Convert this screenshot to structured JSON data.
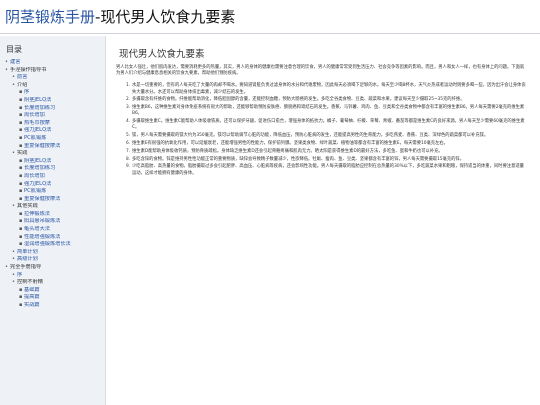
{
  "header": {
    "site_name": "阴茎锻炼手册",
    "page_title": "-现代男人饮食九要素"
  },
  "toc": {
    "title": "目录",
    "items": [
      {
        "level": 0,
        "bullet": "",
        "label": "建言",
        "link": true
      },
      {
        "level": 0,
        "bullet": "",
        "label": "手淫操作指导书",
        "link": false
      },
      {
        "level": 1,
        "bullet": "",
        "label": "前言",
        "link": true
      },
      {
        "level": 1,
        "bullet": "",
        "label": "介绍",
        "link": false
      },
      {
        "level": 2,
        "bullet": "",
        "label": "序",
        "link": true
      },
      {
        "level": 2,
        "bullet": "",
        "label": "阴茎JELQ法",
        "link": true
      },
      {
        "level": 2,
        "bullet": "",
        "label": "长度增加练习",
        "link": true
      },
      {
        "level": 2,
        "bullet": "",
        "label": "周长增加",
        "link": true
      },
      {
        "level": 2,
        "bullet": "",
        "label": "热毛巾按摩",
        "link": true
      },
      {
        "level": 2,
        "bullet": "",
        "label": "强力JELQ法",
        "link": true
      },
      {
        "level": 2,
        "bullet": "",
        "label": "PC肌锻炼",
        "link": true
      },
      {
        "level": 2,
        "bullet": "",
        "label": "重复保健按摩法",
        "link": true
      },
      {
        "level": 1,
        "bullet": "",
        "label": "实践",
        "link": false
      },
      {
        "level": 2,
        "bullet": "",
        "label": "阴茎JELQ法",
        "link": true
      },
      {
        "level": 2,
        "bullet": "",
        "label": "长度增加练习",
        "link": true
      },
      {
        "level": 2,
        "bullet": "",
        "label": "周长增加",
        "link": true
      },
      {
        "level": 2,
        "bullet": "",
        "label": "强力JELQ法",
        "link": true
      },
      {
        "level": 2,
        "bullet": "",
        "label": "PC肌锻炼",
        "link": true
      },
      {
        "level": 2,
        "bullet": "",
        "label": "重复保健按摩法",
        "link": true
      },
      {
        "level": 1,
        "bullet": "",
        "label": "其他实践",
        "link": false
      },
      {
        "level": 2,
        "bullet": "",
        "label": "拉伸锻炼法",
        "link": true
      },
      {
        "level": 2,
        "bullet": "",
        "label": "阳具悬吊锻炼法",
        "link": true
      },
      {
        "level": 2,
        "bullet": "",
        "label": "龟头增大法",
        "link": true
      },
      {
        "level": 2,
        "bullet": "",
        "label": "性能增强锻炼法",
        "link": true
      },
      {
        "level": 2,
        "bullet": "",
        "label": "湿润增强锻炼增长法",
        "link": true
      },
      {
        "level": 1,
        "bullet": "",
        "label": "简单计划",
        "link": true
      },
      {
        "level": 1,
        "bullet": "",
        "label": "高级计划",
        "link": true
      },
      {
        "level": 0,
        "bullet": "",
        "label": "完全手册指导",
        "link": false
      },
      {
        "level": 1,
        "bullet": "",
        "label": "序",
        "link": true
      },
      {
        "level": 1,
        "bullet": "",
        "label": "控制不射精",
        "link": false
      },
      {
        "level": 2,
        "bullet": "",
        "label": "基础篇",
        "link": true
      },
      {
        "level": 2,
        "bullet": "",
        "label": "提高篇",
        "link": true
      },
      {
        "level": 2,
        "bullet": "",
        "label": "实战篇",
        "link": true
      }
    ]
  },
  "content": {
    "title": "现代男人饮食九要素",
    "intro": "男人比女人强壮，他们肌肉发达，需要消耗更多的热量，其实，男人的身体的健康也需要注意合理的饮食，男人的健康常常受到生活压力、社会竞争等因素的影响。而且，男人和女人一样，也有身体上的问题。下面就为男人们介绍与健康息息相关的饮食九要素，帮助他们预防疾病。",
    "items": [
      "水是一切重要的，但有的人每天吃了大量的肉却不喝水。要知道肾脏负责过滤身体的水分和代谢废物，因此每天必须喝下足够的水。每天至少喝8杯水，天气炎热或者运动时则要多喝一些，因为出汗会让身体丧失大量水分。水还可以帮助身体排出毒素，减少结石的发生。",
      "多摄取含有纤维的食物。纤维能帮助消化，降低胆固醇的含量，还能控制血糖，预防大肠癌的发生。多吃全谷类食物、豆类、蔬菜和水果。建议每天至少摄取25~35克的纤维。",
      "维生素B6，这种维生素对身体免疫系统有很大的帮助，还能够帮助预防皮肤癌、膀胱癌和肾结石的发生。香蕉、马铃薯、鸡肉、鱼、豆类和全谷类食物中都含有丰富的维生素B6。男人每天需要2毫克的维生素B6。",
      "多摄取维生素C。维生素C能帮助人体吸收铁质，还可以保护牙龈，促进伤口愈合，增强身体的抵抗力。橘子、葡萄柚、柠檬、草莓、青椒、番茄等都是维生素C的良好来源。男人每天至少需要60毫克的维生素C。",
      "镁，男人每天需要摄取的镁大约为350毫克。镁可以帮助调节心脏的功能，降低血压，预防心脏病的发生，还能提高男性的生育能力。多吃燕麦、香蕉、豆类、深绿色的蔬菜都可以补充镁。",
      "维生素E有很强的抗氧化作用，可以延缓衰老，还能增强男性的性能力，保护前列腺。坚果类食物、绿叶蔬菜、植物油等都含有丰富的维生素E，每天需要10毫克左右。",
      "维生素D能帮助身体吸收钙质，预防骨质疏松。身体缺乏维生素D还会引起骨骼疼痛和肌肉无力。晒太阳是获得维生素D的最好方法，多吃鱼、蛋和牛奶也可以补充。",
      "多吃含锌的食物。锌是维持男性性功能正常的重要物质，缺锌会导致精子数量减少，性欲降低。牡蛎、瘦肉、鱼、豆类、坚果都含有丰富的锌，男人每天需要摄取15毫克的锌。",
      "少吃高脂肪、高热量的食物。脂肪摄取过多会引起肥胖、高血压、心脏病等疾病，还会影响性功能。男人每天摄取的脂肪应控制在总热量的30%以下，多吃蔬菜水果和粗粮，保持适当的体重，同时要注意适量运动，这样才能拥有健康的身体。"
    ]
  }
}
